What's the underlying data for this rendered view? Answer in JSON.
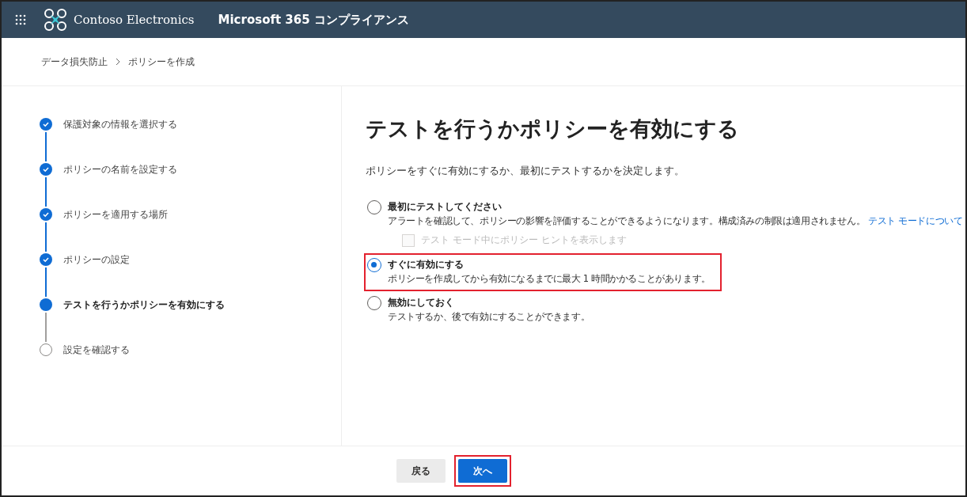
{
  "header": {
    "org_name": "Contoso Electronics",
    "app_title": "Microsoft 365 コンプライアンス"
  },
  "breadcrumb": [
    "データ損失防止",
    "ポリシーを作成"
  ],
  "steps": [
    {
      "label": "保護対象の情報を選択する",
      "completed": true,
      "current": false
    },
    {
      "label": "ポリシーの名前を設定する",
      "completed": true,
      "current": false
    },
    {
      "label": "ポリシーを適用する場所",
      "completed": true,
      "current": false
    },
    {
      "label": "ポリシーの設定",
      "completed": true,
      "current": false
    },
    {
      "label": "テストを行うかポリシーを有効にする",
      "completed": false,
      "current": true
    },
    {
      "label": "設定を確認する",
      "completed": false,
      "current": false
    }
  ],
  "page": {
    "title": "テストを行うかポリシーを有効にする",
    "description": "ポリシーをすぐに有効にするか、最初にテストするかを決定します。"
  },
  "options": [
    {
      "label": "最初にテストしてください",
      "description": "アラートを確認して、ポリシーの影響を評価することができるようになります。構成済みの制限は適用されません。",
      "link": "テスト モードについて",
      "selected": false,
      "highlighted": false,
      "sub_checkbox": {
        "label": "テスト モード中にポリシー ヒントを表示します",
        "checked": false,
        "disabled": true
      }
    },
    {
      "label": "すぐに有効にする",
      "description": "ポリシーを作成してから有効になるまでに最大 1 時間かかることがあります。",
      "selected": true,
      "highlighted": true
    },
    {
      "label": "無効にしておく",
      "description": "テストするか、後で有効にすることができます。",
      "selected": false,
      "highlighted": false
    }
  ],
  "footer": {
    "buttons": [
      {
        "label": "戻る",
        "kind": "secondary",
        "highlighted": false
      },
      {
        "label": "次へ",
        "kind": "primary",
        "highlighted": true
      }
    ]
  }
}
